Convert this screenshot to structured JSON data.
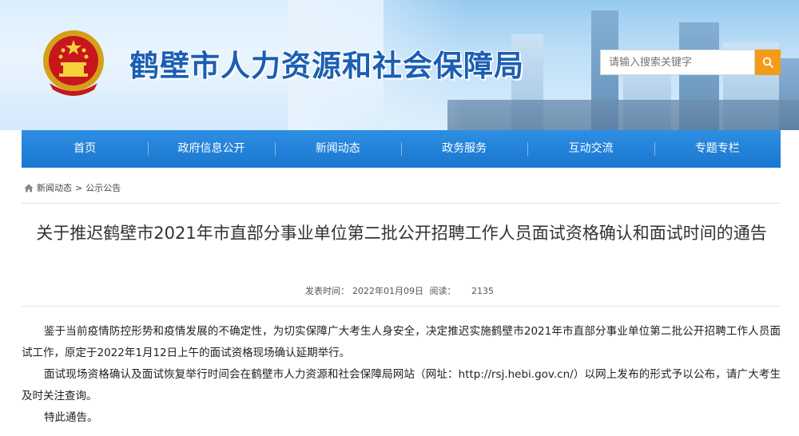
{
  "header": {
    "site_title": "鹤壁市人力资源和社会保障局",
    "search_placeholder": "请输入搜索关键字"
  },
  "nav": {
    "items": [
      "首页",
      "政府信息公开",
      "新闻动态",
      "政务服务",
      "互动交流",
      "专题专栏"
    ]
  },
  "breadcrumb": {
    "items": [
      "新闻动态",
      "公示公告"
    ],
    "separator": ">"
  },
  "article": {
    "title": "关于推迟鹤壁市2021年市直部分事业单位第二批公开招聘工作人员面试资格确认和面试时间的通告",
    "publish_label": "发表时间：",
    "publish_date": "2022年01月09日",
    "views_label": "阅读：",
    "views": "2135",
    "paragraphs": [
      "鉴于当前疫情防控形势和疫情发展的不确定性，为切实保障广大考生人身安全，决定推迟实施鹤壁市2021年市直部分事业单位第二批公开招聘工作人员面试工作，原定于2022年1月12日上午的面试资格现场确认延期举行。",
      "面试现场资格确认及面试恢复举行时间会在鹤壁市人力资源和社会保障局网站（网址：http://rsj.hebi.gov.cn/）以网上发布的形式予以公布，请广大考生及时关注查询。",
      "特此通告。"
    ]
  },
  "colors": {
    "nav_bg": "#1f7fd6",
    "title_blue": "#1b5fb4",
    "search_button": "#f39c1a"
  }
}
